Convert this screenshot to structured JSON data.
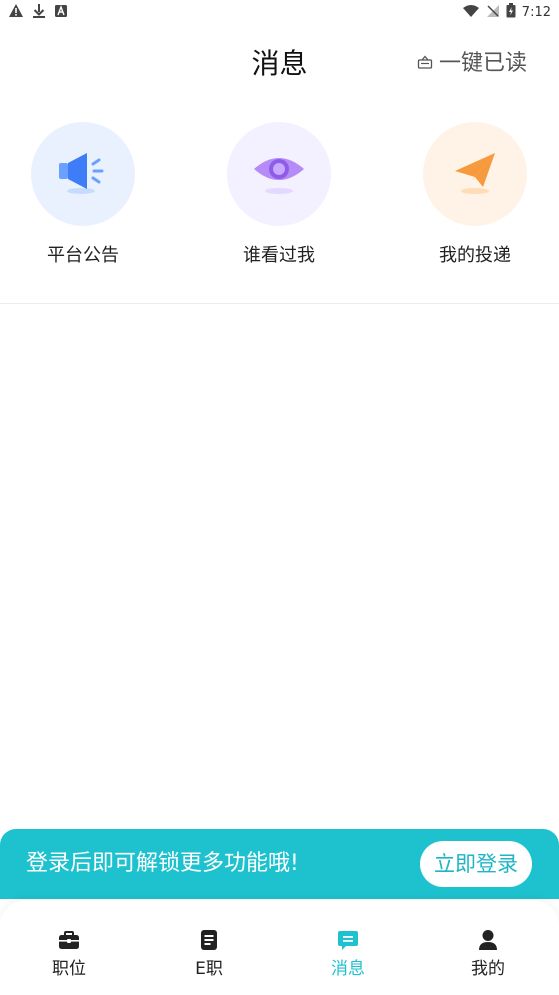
{
  "status_bar": {
    "time": "7:12",
    "left_icons": [
      "warning-icon",
      "download-icon",
      "font-icon"
    ],
    "right_icons": [
      "wifi-icon",
      "no-signal-icon",
      "battery-charging-icon"
    ]
  },
  "header": {
    "title": "消息",
    "mark_all_read": "一键已读"
  },
  "entries": [
    {
      "label": "平台公告",
      "icon": "megaphone-icon",
      "color": "#4a86ff"
    },
    {
      "label": "谁看过我",
      "icon": "eye-icon",
      "color": "#a57cf5"
    },
    {
      "label": "我的投递",
      "icon": "paper-plane-icon",
      "color": "#f7963a"
    }
  ],
  "login_banner": {
    "text": "登录后即可解锁更多功能哦!",
    "button": "立即登录"
  },
  "tab_bar": {
    "tabs": [
      {
        "label": "职位",
        "icon": "briefcase-icon",
        "active": false
      },
      {
        "label": "E职",
        "icon": "document-icon",
        "active": false
      },
      {
        "label": "消息",
        "icon": "message-icon",
        "active": true
      },
      {
        "label": "我的",
        "icon": "user-icon",
        "active": false
      }
    ]
  },
  "colors": {
    "accent": "#1ec2cf",
    "text": "#222222"
  }
}
